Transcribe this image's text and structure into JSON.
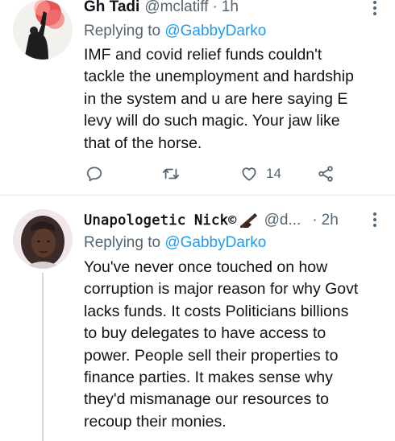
{
  "tweets": [
    {
      "name": "Gh Tadi",
      "handle": "@mclatiff",
      "separator": "·",
      "time": "1h",
      "reply_prefix": "Replying to",
      "reply_to": "@GabbyDarko",
      "lines": [
        "IMF and covid relief funds couldn't",
        "tackle the unemployment and hardship",
        "in the system and u are here saying E",
        "levy will do such magic. Your jaw like",
        "that of the horse."
      ],
      "like_count": "14"
    },
    {
      "name": "𝚄𝚗𝚊𝚙𝚘𝚕𝚘𝚐𝚎𝚝𝚒𝚌 𝙽𝚒𝚌𝚔©",
      "handle": "@d...",
      "separator": "·",
      "time": "2h",
      "reply_prefix": "Replying to",
      "reply_to": "@GabbyDarko",
      "lines": [
        "You've never once touched on how",
        "corruption is major reason for why Govt",
        "lacks funds. It costs Politicians billions",
        "to buy delegates to have access to",
        "power. People sell their properties to",
        "finance parties. It makes sense why",
        "they'd mismanage our resources to",
        "recoup their monies."
      ]
    }
  ],
  "icons": {
    "reply": "reply-icon",
    "retweet": "retweet-icon",
    "like": "heart-icon",
    "share": "share-icon",
    "more": "more-icon"
  },
  "colors": {
    "link": "#1d9bf0",
    "secondary_text": "#536471",
    "divider": "#e6ecf0"
  }
}
